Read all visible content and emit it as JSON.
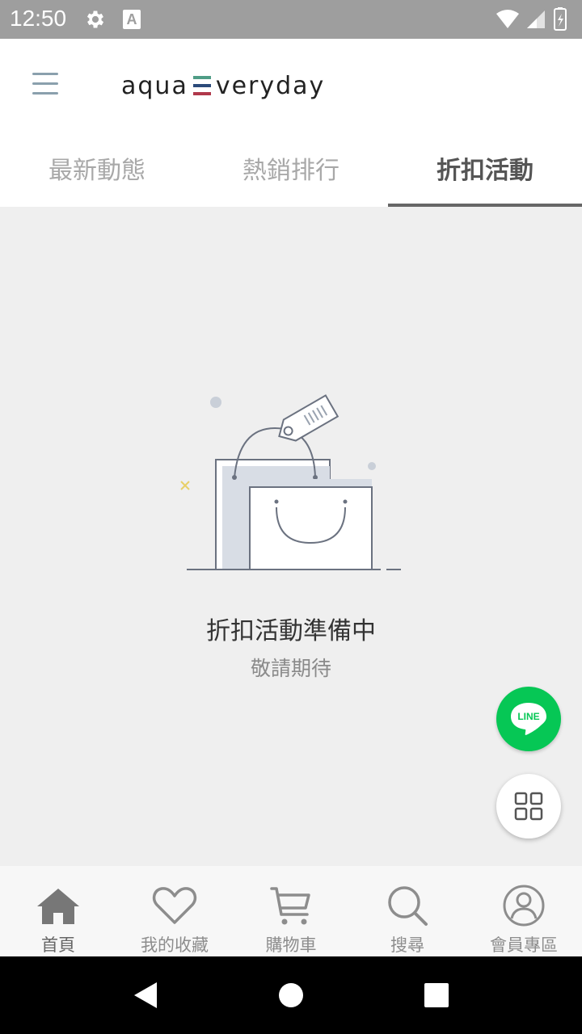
{
  "status_bar": {
    "time": "12:50",
    "letter": "A"
  },
  "app": {
    "logo_left": "aqua",
    "logo_right": "veryday",
    "logo_colors": [
      "#4f9d86",
      "#2b4a7a",
      "#b0384b"
    ]
  },
  "tabs": [
    {
      "label": "最新動態",
      "active": false
    },
    {
      "label": "熱銷排行",
      "active": false
    },
    {
      "label": "折扣活動",
      "active": true
    }
  ],
  "empty_state": {
    "title": "折扣活動準備中",
    "subtitle": "敬請期待"
  },
  "fabs": {
    "line_label": "LINE",
    "line_color": "#06c755"
  },
  "bottom_nav": [
    {
      "label": "首頁",
      "icon": "home-icon"
    },
    {
      "label": "我的收藏",
      "icon": "heart-icon"
    },
    {
      "label": "購物車",
      "icon": "cart-icon"
    },
    {
      "label": "搜尋",
      "icon": "search-icon"
    },
    {
      "label": "會員專區",
      "icon": "user-icon"
    }
  ]
}
